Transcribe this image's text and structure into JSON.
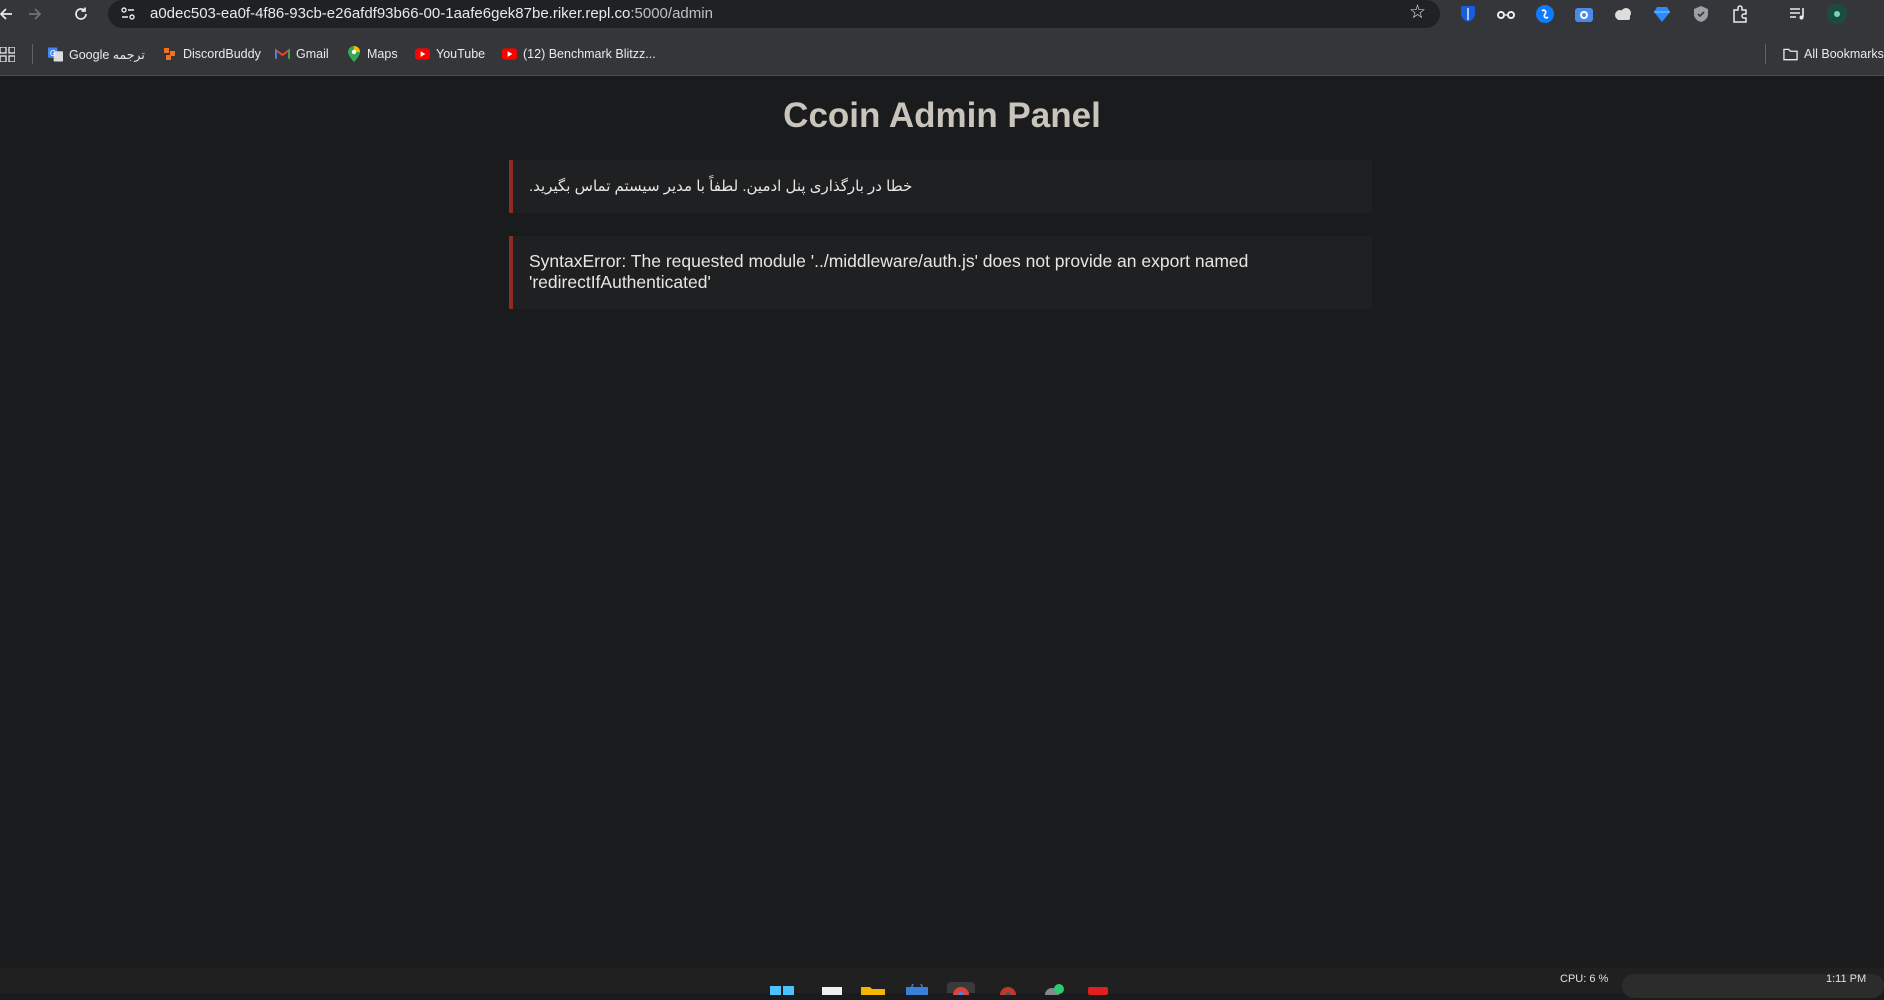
{
  "browser": {
    "url_host": "a0dec503-ea0f-4f86-93cb-e26afdf93b66-00-1aafe6gek87be.riker.repl.co",
    "url_path": ":5000/admin",
    "bookmarks": [
      {
        "label": "Google ترجمه",
        "icon": "google-translate-icon"
      },
      {
        "label": "DiscordBuddy",
        "icon": "discordbuddy-icon"
      },
      {
        "label": "Gmail",
        "icon": "gmail-icon"
      },
      {
        "label": "Maps",
        "icon": "maps-icon"
      },
      {
        "label": "YouTube",
        "icon": "youtube-icon"
      },
      {
        "label": "(12) Benchmark Blitzz...",
        "icon": "youtube-icon"
      }
    ],
    "all_bookmarks": "All Bookmarks",
    "extensions": [
      "bitwarden-icon",
      "glasses-icon",
      "shazam-icon",
      "camera-icon",
      "puzzle-cloud-icon",
      "diamond-icon",
      "shield-icon",
      "extensions-icon",
      "media-icon",
      "profile-icon"
    ]
  },
  "page": {
    "title": "Ccoin Admin Panel",
    "error_message_fa": "خطا در بارگذاری پنل ادمین. لطفاً با مدیر سیستم تماس بگیرید.",
    "error_detail": "SyntaxError: The requested module '../middleware/auth.js' does not provide an export named 'redirectIfAuthenticated'",
    "error_border_color": "#8e2b24"
  },
  "taskbar": {
    "cpu": "CPU: 6 %",
    "time": "1:11 PM",
    "apps": [
      "start-icon",
      "file-icon",
      "folder-icon",
      "store-icon",
      "chrome-icon",
      "chrome-dev-icon",
      "app-check-icon",
      "app-red-icon"
    ]
  }
}
